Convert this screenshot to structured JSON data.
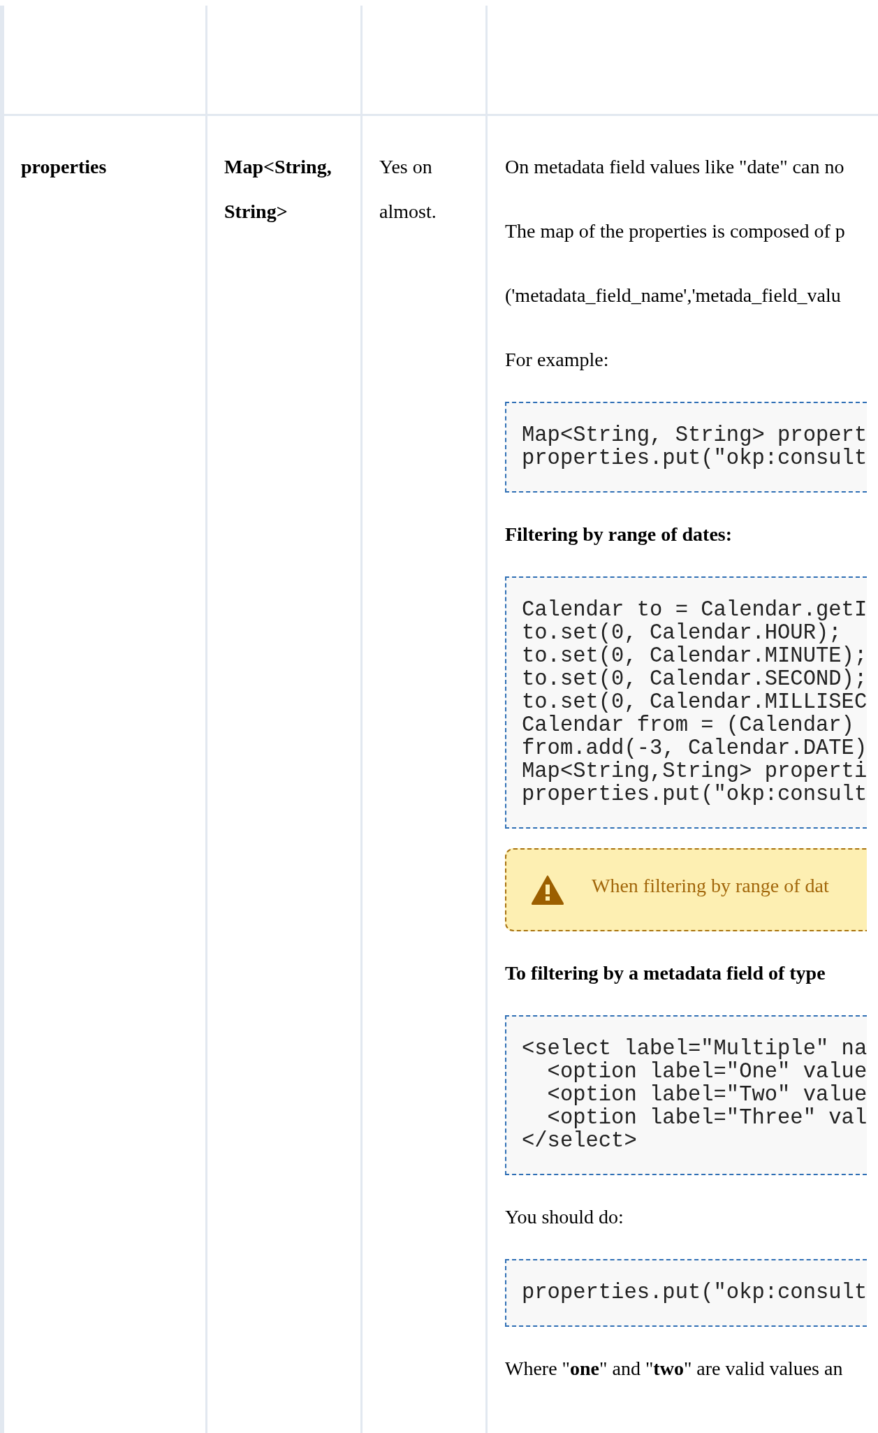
{
  "table": {
    "rows": [
      {
        "name": "properties",
        "type": "Map<String, String>",
        "required": "Yes on almost.",
        "description": [
          {
            "kind": "paragraph",
            "text": "On metadata field values like \"date\" can no"
          },
          {
            "kind": "paragraph",
            "text": "The map of the properties is composed of p"
          },
          {
            "kind": "paragraph",
            "text": "('metadata_field_name','metada_field_valu"
          },
          {
            "kind": "paragraph",
            "text": "For example:"
          },
          {
            "kind": "code",
            "lines": [
              "Map<String, String> propert",
              "properties.put(\"okp:consult"
            ]
          },
          {
            "kind": "heading",
            "text": "Filtering by range of dates:"
          },
          {
            "kind": "code",
            "lines": [
              "Calendar to = Calendar.getI",
              "to.set(0, Calendar.HOUR);",
              "to.set(0, Calendar.MINUTE);",
              "to.set(0, Calendar.SECOND);",
              "to.set(0, Calendar.MILLISEC",
              "Calendar from = (Calendar)",
              "from.add(-3, Calendar.DATE)",
              "Map<String,String> properti",
              "properties.put(\"okp:consult"
            ]
          },
          {
            "kind": "warning",
            "text": "When filtering by range of dat"
          },
          {
            "kind": "heading",
            "text": "To filtering by a metadata field of type"
          },
          {
            "kind": "code",
            "lines": [
              "<select label=\"Multiple\" na",
              "  <option label=\"One\" value",
              "  <option label=\"Two\" value",
              "  <option label=\"Three\" val",
              "</select>"
            ]
          },
          {
            "kind": "paragraph",
            "text": "You should do:"
          },
          {
            "kind": "code",
            "lines": [
              "properties.put(\"okp:consult"
            ]
          },
          {
            "kind": "paragraph",
            "text": "Where \"**one**\" and \"**two**\" are valid values an"
          }
        ]
      }
    ]
  }
}
